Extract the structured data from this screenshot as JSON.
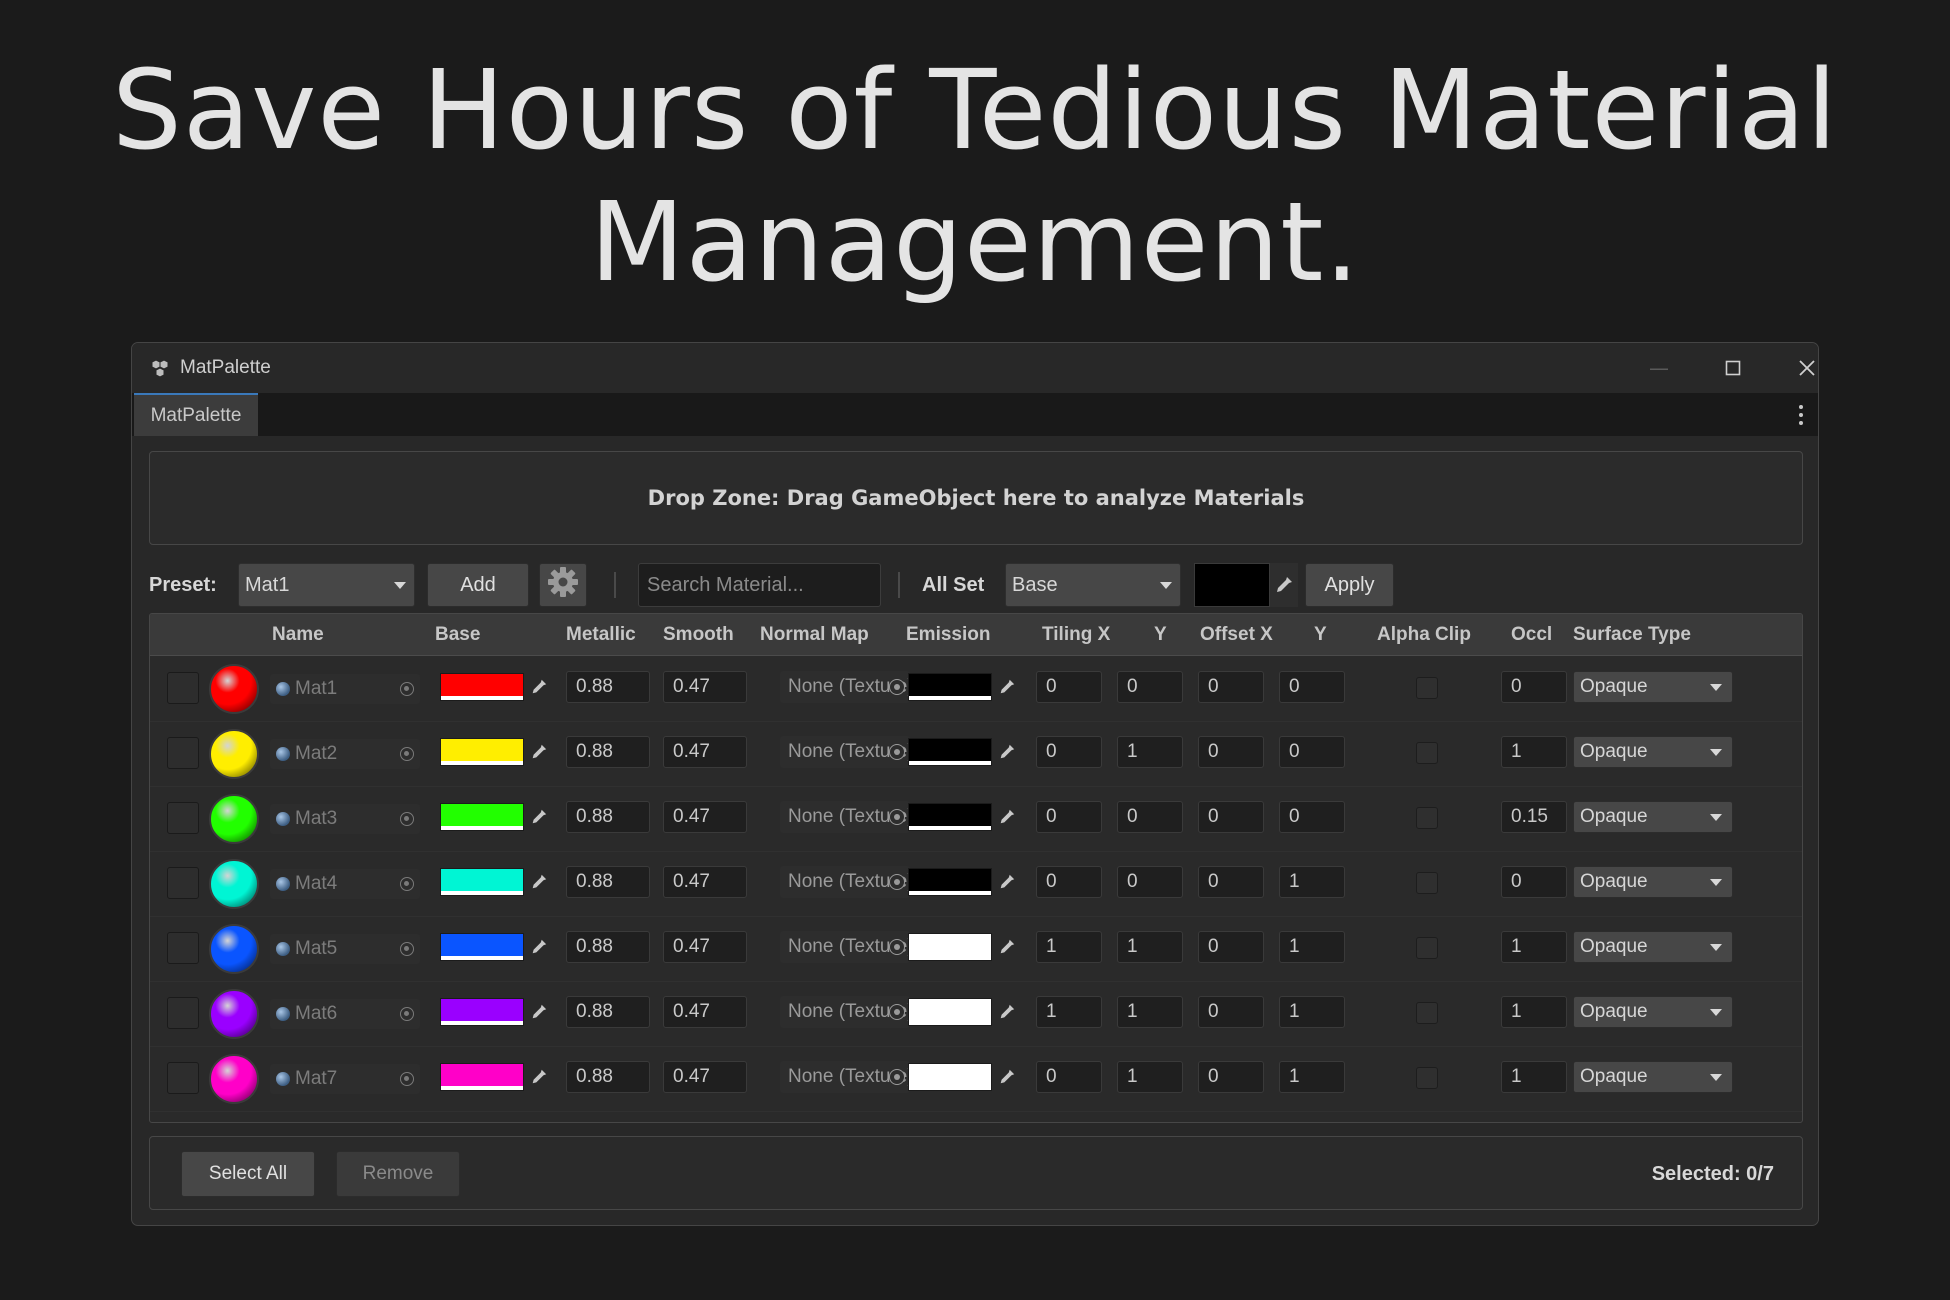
{
  "headline": {
    "line1": "Save Hours of Tedious Material",
    "line2": "Management."
  },
  "window": {
    "title": "MatPalette",
    "tab": "MatPalette",
    "controls": [
      "minimize-icon",
      "maximize-icon",
      "close-icon"
    ]
  },
  "dropzone": {
    "text": "Drop Zone: Drag GameObject here to analyze Materials"
  },
  "toolbar": {
    "preset_label": "Preset:",
    "preset_value": "Mat1",
    "add_label": "Add",
    "search_placeholder": "Search Material...",
    "allset_label": "All Set",
    "allset_value": "Base",
    "allset_color": "#000000",
    "apply_label": "Apply"
  },
  "table": {
    "headers": {
      "name": "Name",
      "base": "Base",
      "metallic": "Metallic",
      "smooth": "Smooth",
      "normal": "Normal Map",
      "emission": "Emission",
      "tilingx": "Tiling X",
      "tilingy": "Y",
      "offsetx": "Offset X",
      "offsety": "Y",
      "alphaclip": "Alpha Clip",
      "occl": "Occl",
      "surface": "Surface Type"
    },
    "rows": [
      {
        "name": "Mat1",
        "base": "#ff0000",
        "metallic": "0.88",
        "smooth": "0.47",
        "normal": "None (Texture)",
        "emission": "#000000",
        "tx": "0",
        "ty": "0",
        "ox": "0",
        "oy": "0",
        "occl": "0",
        "surface": "Opaque"
      },
      {
        "name": "Mat2",
        "base": "#ffee00",
        "metallic": "0.88",
        "smooth": "0.47",
        "normal": "None (Texture)",
        "emission": "#000000",
        "tx": "0",
        "ty": "1",
        "ox": "0",
        "oy": "0",
        "occl": "1",
        "surface": "Opaque"
      },
      {
        "name": "Mat3",
        "base": "#22ff00",
        "metallic": "0.88",
        "smooth": "0.47",
        "normal": "None (Texture)",
        "emission": "#000000",
        "tx": "0",
        "ty": "0",
        "ox": "0",
        "oy": "0",
        "occl": "0.15",
        "surface": "Opaque"
      },
      {
        "name": "Mat4",
        "base": "#00f5d4",
        "metallic": "0.88",
        "smooth": "0.47",
        "normal": "None (Texture)",
        "emission": "#000000",
        "tx": "0",
        "ty": "0",
        "ox": "0",
        "oy": "1",
        "occl": "0",
        "surface": "Opaque"
      },
      {
        "name": "Mat5",
        "base": "#0a55ff",
        "metallic": "0.88",
        "smooth": "0.47",
        "normal": "None (Texture)",
        "emission": "#ffffff",
        "tx": "1",
        "ty": "1",
        "ox": "0",
        "oy": "1",
        "occl": "1",
        "surface": "Opaque"
      },
      {
        "name": "Mat6",
        "base": "#9a00ff",
        "metallic": "0.88",
        "smooth": "0.47",
        "normal": "None (Texture)",
        "emission": "#ffffff",
        "tx": "1",
        "ty": "1",
        "ox": "0",
        "oy": "1",
        "occl": "1",
        "surface": "Opaque"
      },
      {
        "name": "Mat7",
        "base": "#ff00c8",
        "metallic": "0.88",
        "smooth": "0.47",
        "normal": "None (Texture)",
        "emission": "#ffffff",
        "tx": "0",
        "ty": "1",
        "ox": "0",
        "oy": "1",
        "occl": "1",
        "surface": "Opaque"
      }
    ]
  },
  "footer": {
    "select_all": "Select All",
    "remove": "Remove",
    "selected": "Selected: 0/7"
  }
}
